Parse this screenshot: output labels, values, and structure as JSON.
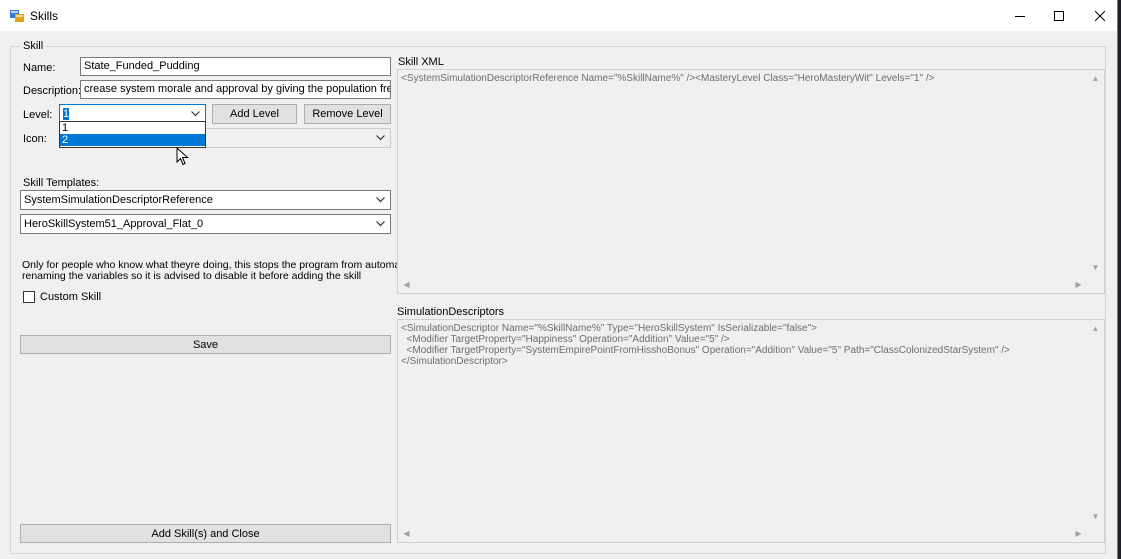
{
  "window": {
    "title": "Skills",
    "icons": {
      "app": "app-icon",
      "minimize": "minimize-icon",
      "maximize": "maximize-icon",
      "close": "close-icon"
    }
  },
  "skill": {
    "group_label": "Skill",
    "name_label": "Name:",
    "name_value": "State_Funded_Pudding",
    "description_label": "Description:",
    "description_value": "crease system morale and approval by giving the population free pudding.",
    "level_label": "Level:",
    "level_value": "1",
    "level_options": [
      "1",
      "2"
    ],
    "add_level_label": "Add Level",
    "remove_level_label": "Remove Level",
    "icon_label": "Icon:",
    "icon_value": "",
    "templates_label": "Skill Templates:",
    "template_1": "SystemSimulationDescriptorReference",
    "template_2": "HeroSkillSystem51_Approval_Flat_0",
    "warning_line_1": "Only for people who know what theyre doing, this stops the program from automatically",
    "warning_line_2": "renaming the variables so it is advised to disable it before adding the skill",
    "custom_skill_label": "Custom Skill",
    "save_label": "Save",
    "add_close_label": "Add Skill(s) and Close"
  },
  "xml": {
    "skill_xml_label": "Skill XML",
    "skill_xml_text": "<SystemSimulationDescriptorReference Name=\"%SkillName%\" /><MasteryLevel Class=\"HeroMasteryWit\" Levels=\"1\" />",
    "sim_label": "SimulationDescriptors",
    "sim_line_1": "<SimulationDescriptor Name=\"%SkillName%\" Type=\"HeroSkillSystem\" IsSerializable=\"false\">",
    "sim_line_2": "  <Modifier TargetProperty=\"Happiness\" Operation=\"Addition\" Value=\"5\" />",
    "sim_line_3": "  <Modifier TargetProperty=\"SystemEmpirePointFromHisshoBonus\" Operation=\"Addition\" Value=\"5\" Path=\"ClassColonizedStarSystem\" />",
    "sim_line_4": "</SimulationDescriptor>"
  }
}
